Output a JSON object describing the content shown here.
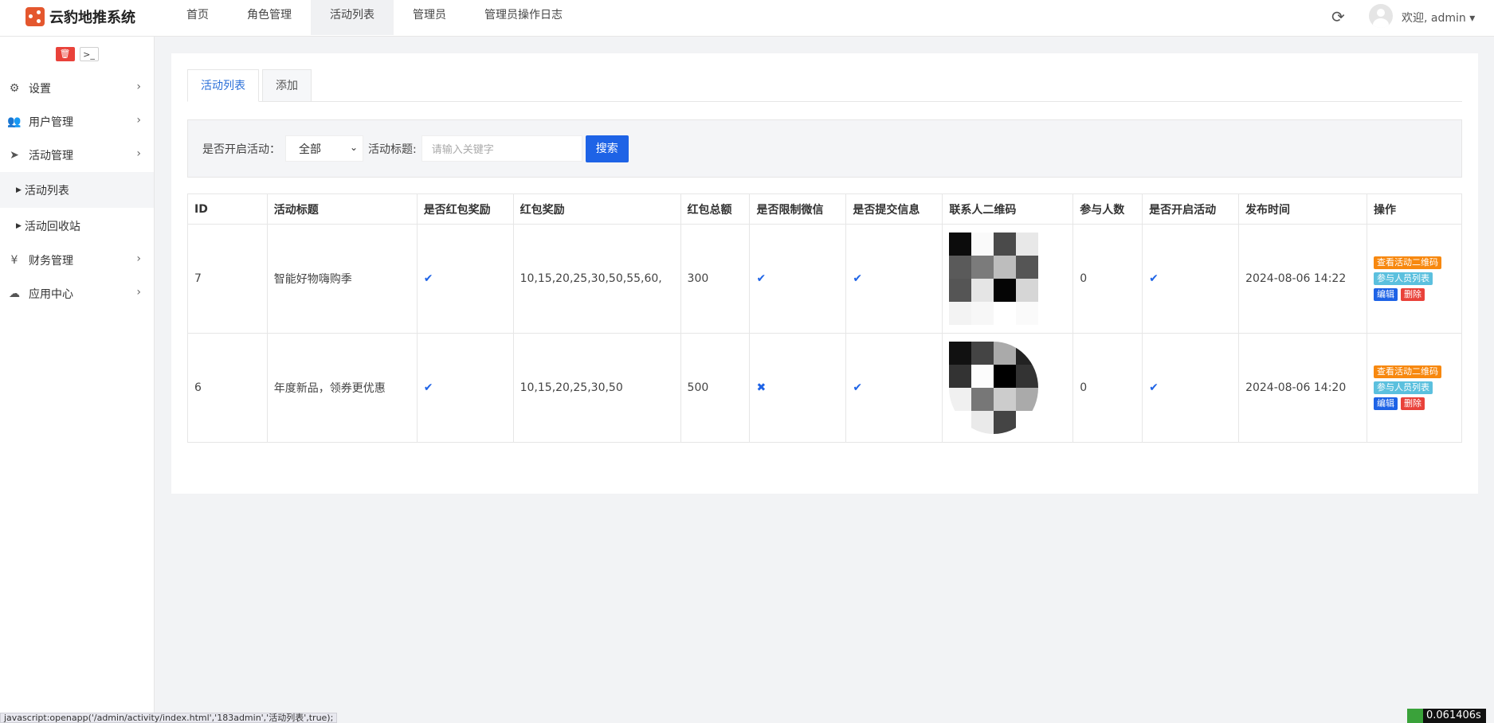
{
  "app": {
    "title": "云豹地推系统",
    "brand_color": "#e4572e"
  },
  "header": {
    "nav": [
      "首页",
      "角色管理",
      "活动列表",
      "管理员",
      "管理员操作日志"
    ],
    "active_index": 2,
    "refresh_icon": "⟳",
    "user_greeting": "欢迎, admin ▾"
  },
  "sidebar": {
    "tools": {
      "delete_icon": "🗑",
      "console_icon": ">_"
    },
    "menu": [
      {
        "label": "设置",
        "icon": "⚙"
      },
      {
        "label": "用户管理",
        "icon": "👥"
      },
      {
        "label": "活动管理",
        "icon": "➤"
      }
    ],
    "submenu": [
      "活动列表",
      "活动回收站"
    ],
    "menu_after": [
      {
        "label": "财务管理",
        "icon": "¥"
      },
      {
        "label": "应用中心",
        "icon": "☁"
      }
    ],
    "arrow": "›"
  },
  "tabs": [
    "活动列表",
    "添加"
  ],
  "filter": {
    "status_label": "是否开启活动：",
    "status_value": "全部",
    "title_label": "活动标题:",
    "title_placeholder": "请输入关键字",
    "search_label": "搜索"
  },
  "table": {
    "headers": [
      "ID",
      "活动标题",
      "是否红包奖励",
      "红包奖励",
      "红包总额",
      "是否限制微信",
      "是否提交信息",
      "联系人二维码",
      "参与人数",
      "是否开启活动",
      "发布时间",
      "操作"
    ],
    "rows": [
      {
        "id": "7",
        "title": "智能好物嗨购季",
        "reward_enabled": "✔",
        "rewards": "10,15,20,25,30,50,55,60,",
        "total": "300",
        "limit_wechat": "✔",
        "submit_info": "✔",
        "participants": "0",
        "active": "✔",
        "time": "2024-08-06 14:22"
      },
      {
        "id": "6",
        "title": "年度新品，领券更优惠",
        "reward_enabled": "✔",
        "rewards": "10,15,20,25,30,50",
        "total": "500",
        "limit_wechat": "✖",
        "submit_info": "✔",
        "participants": "0",
        "active": "✔",
        "time": "2024-08-06 14:20"
      }
    ],
    "actions": {
      "view_qr": "查看活动二维码",
      "participants": "参与人员列表",
      "edit": "编辑",
      "delete": "删除"
    }
  },
  "status_bar": {
    "url": "javascript:openapp('/admin/activity/index.html','183admin','活动列表',true);",
    "timer": "0.061406s"
  }
}
